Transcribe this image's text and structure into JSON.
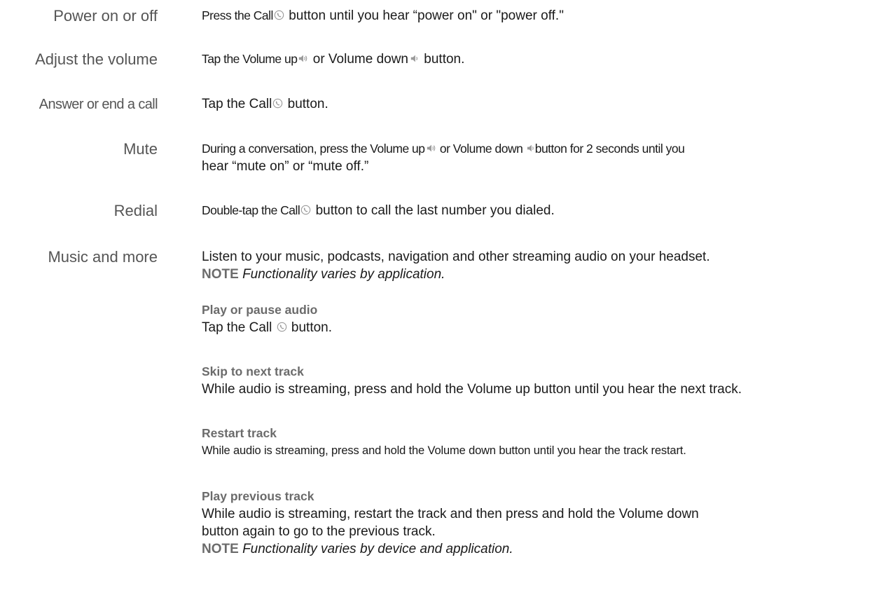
{
  "rows": {
    "power": {
      "label": "Power on or off",
      "pre": "Press the Call",
      "post": " button until you hear “power on\" or \"power off.\""
    },
    "volume": {
      "label": "Adjust the volume",
      "pre": "Tap the Volume up",
      "mid": " or Volume down",
      "post": "  button."
    },
    "answer": {
      "label": "Answer or end a call",
      "pre": "Tap the Call",
      "post": " button."
    },
    "mute": {
      "label": "Mute",
      "pre": "During a conversation, press the Volume up",
      "mid": " or Volume down ",
      "post": "button for 2 seconds until you",
      "line2": "hear “mute on” or “mute off.”"
    },
    "redial": {
      "label": "Redial",
      "pre": "Double-tap the Call",
      "post": " button to call the last number you dialed."
    },
    "music": {
      "label": "Music and more",
      "intro": "Listen to your music, podcasts, navigation and other streaming audio on your headset.",
      "note_kw": "NOTE",
      "note_text": "Functionality varies by application.",
      "play_pause": {
        "heading": "Play or pause audio",
        "pre": "Tap the Call ",
        "post": " button."
      },
      "skip": {
        "heading": "Skip to next track",
        "text": "While audio is streaming, press and hold the Volume up button until you hear the next track."
      },
      "restart": {
        "heading": "Restart track",
        "text": "While audio is streaming, press and hold the Volume down button until you hear the track restart."
      },
      "previous": {
        "heading": "Play previous track",
        "line1": "While audio is streaming, restart the track and then press and hold the Volume down",
        "line2": "button again to go to the previous track.",
        "note_kw": "NOTE",
        "note_text": "Functionality varies by device and application."
      }
    }
  },
  "icons": {
    "call": "call-icon",
    "volume_up": "volume-up-icon",
    "volume_down": "volume-down-icon"
  },
  "colors": {
    "label": "#555555",
    "heading": "#6b6b6b",
    "text": "#1a1a1a",
    "icon": "#9a9a9a"
  }
}
